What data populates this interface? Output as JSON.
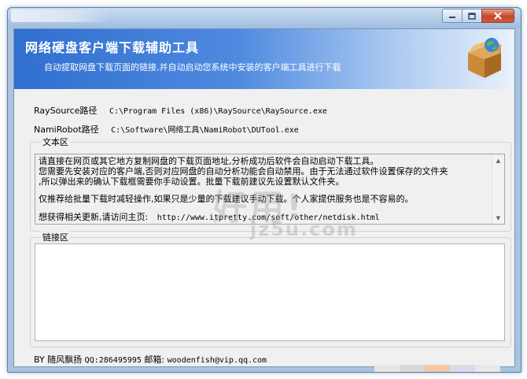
{
  "window": {
    "banner_title": "网络硬盘客户端下载辅助工具",
    "banner_subtitle": "自动提取网盘下载页面的链接,并自动启动您系统中安装的客户端工具进行下载",
    "buttons": [
      {
        "name": "minimize-button",
        "icon": "minimize-icon"
      },
      {
        "name": "maximize-button",
        "icon": "maximize-icon"
      },
      {
        "name": "close-button",
        "icon": "close-icon"
      }
    ]
  },
  "paths": {
    "raysource_label": "RaySource路径",
    "raysource_value": "C:\\Program Files (x86)\\RaySource\\RaySource.exe",
    "namirobot_label": "NamiRobot路径",
    "namirobot_value": "C:\\Software\\网络工具\\NamiRobot\\DUTool.exe"
  },
  "text_area": {
    "label": "文本区",
    "lines": [
      "请直接在网页或其它地方复制网盘的下载页面地址,分析成功后软件会自动启动下载工具。",
      "您需要先安装对应的客户端,否则对应网盘的自动分析功能会自动禁用。由于无法通过软件设置保存的文件夹",
      ",所以弹出来的确认下载框需要你手动设置。批量下载前建议先设置默认文件夹。",
      "仅推荐给批量下载时减轻操作,如果只是少量的下载建议手动下载。个人家提供服务也是不容易的。",
      "想获得相关更新,请访问主页:",
      "http://www.itpretty.com/soft/other/netdisk.html"
    ]
  },
  "link_area": {
    "label": "链接区",
    "value": ""
  },
  "footer": {
    "author": "BY 随风飘扬",
    "qq": "QQ:286495995",
    "email_label": "邮箱:",
    "email": "woodenfish@vip.qq.com"
  },
  "watermark": {
    "main": "好用!",
    "sub": "jz5u.com"
  },
  "colors": {
    "banner_start": "#2f6fcf",
    "banner_end": "#e9f1fb",
    "window_frame": "#a9c3e0",
    "close_red": "#c6452a"
  }
}
